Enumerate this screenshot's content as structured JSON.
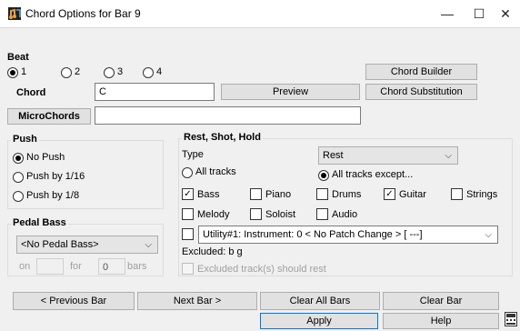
{
  "window": {
    "title": "Chord Options for Bar 9",
    "minimize_glyph": "—",
    "maximize_glyph": "☐",
    "close_glyph": "✕"
  },
  "beat": {
    "section_label": "Beat",
    "options": [
      "1",
      "2",
      "3",
      "4"
    ],
    "selected": "1"
  },
  "chord": {
    "label": "Chord",
    "value": "C"
  },
  "buttons": {
    "chord_builder": "Chord Builder",
    "preview": "Preview",
    "chord_substitution": "Chord Substitution",
    "microchords": "MicroChords",
    "prev_bar": "< Previous Bar",
    "next_bar": "Next Bar >",
    "clear_all_bars": "Clear All Bars",
    "clear_bar": "Clear Bar",
    "apply": "Apply",
    "help": "Help"
  },
  "microchords_value": "",
  "push": {
    "section_label": "Push",
    "options": [
      "No Push",
      "Push by 1/16",
      "Push by 1/8"
    ],
    "selected": "No Push"
  },
  "pedal_bass": {
    "section_label": "Pedal Bass",
    "selected": "<No Pedal Bass>",
    "on_label": "on",
    "on_value": "",
    "for_label": "for",
    "for_value": "0",
    "bars_label": "bars"
  },
  "rest": {
    "section_label": "Rest, Shot, Hold",
    "type_label": "Type",
    "type_value": "Rest",
    "all_tracks": "All tracks",
    "all_tracks_except": "All tracks except...",
    "selected": "All tracks except...",
    "tracks": [
      {
        "label": "Bass",
        "checked": true
      },
      {
        "label": "Piano",
        "checked": false
      },
      {
        "label": "Drums",
        "checked": false
      },
      {
        "label": "Guitar",
        "checked": true
      },
      {
        "label": "Strings",
        "checked": false
      },
      {
        "label": "Melody",
        "checked": false
      },
      {
        "label": "Soloist",
        "checked": false
      },
      {
        "label": "Audio",
        "checked": false
      }
    ],
    "utility_value": "Utility#1: Instrument: 0 < No Patch Change > [ ---]",
    "excluded_text": "Excluded: b g",
    "excluded_rest_label": "Excluded track(s) should rest"
  },
  "colors": {
    "accent": "#0078d7",
    "face": "#f0f0f0",
    "button": "#e1e1e1"
  }
}
